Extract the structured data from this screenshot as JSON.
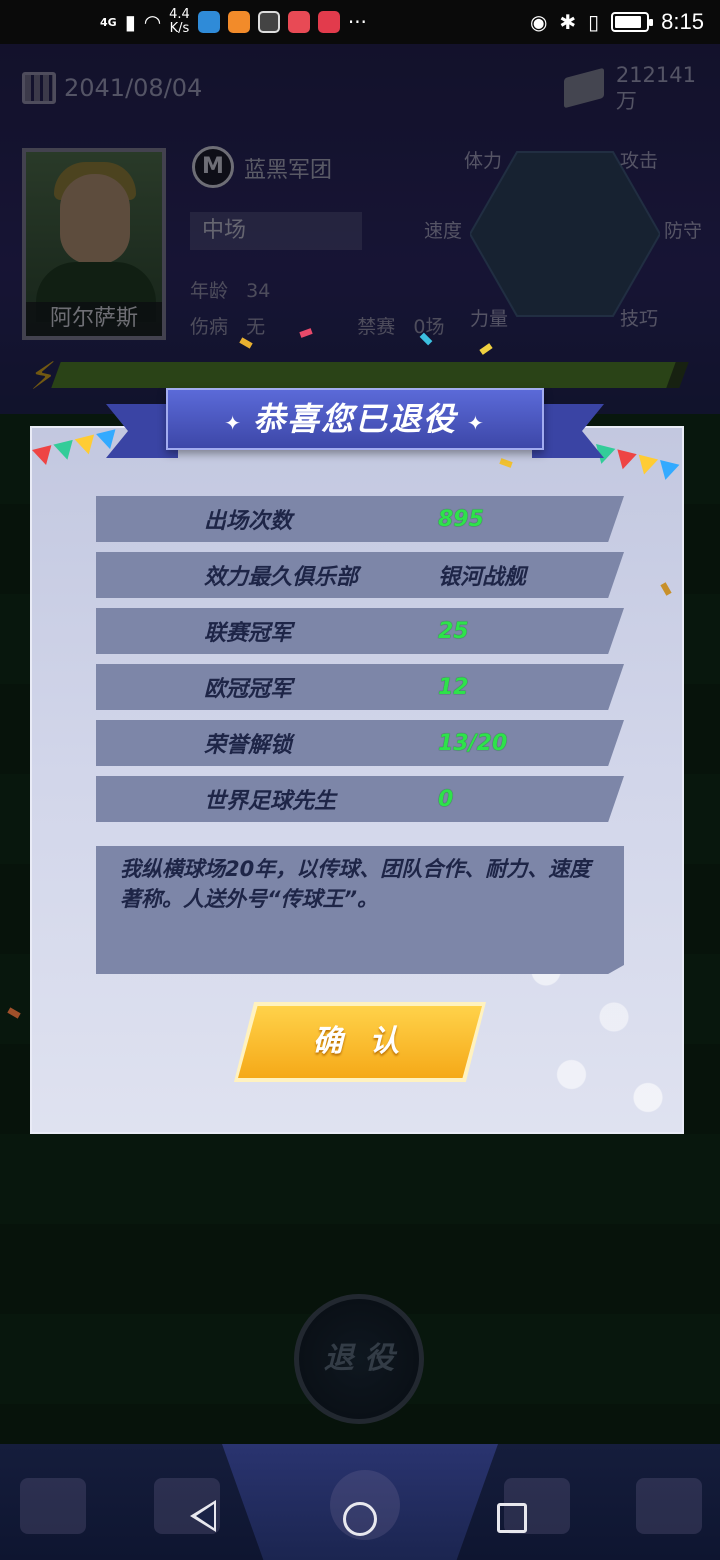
{
  "status_bar": {
    "network": "4G",
    "speed": "4.4\nK/s",
    "time": "8:15",
    "battery_level": 0.85
  },
  "game": {
    "date": "2041/08/04",
    "money_amount": "212141",
    "money_unit": "万",
    "player_name": "阿尔萨斯",
    "club_name": "蓝黑军团",
    "position": "中场",
    "age_label": "年龄",
    "age_value": "34",
    "injury_label": "伤病",
    "injury_value": "无",
    "ban_label": "禁赛",
    "ban_value": "0场",
    "attributes": {
      "stamina": "体力",
      "attack": "攻击",
      "speed": "速度",
      "defense": "防守",
      "strength": "力量",
      "technique": "技巧"
    },
    "xp_fraction": 0.98,
    "retire_button_label": "退 役"
  },
  "dialog": {
    "title": "恭喜您已退役",
    "stats": [
      {
        "label": "出场次数",
        "value": "895",
        "color": "#2ee24a"
      },
      {
        "label": "效力最久俱乐部",
        "value": "银河战舰",
        "color": "#1e2547"
      },
      {
        "label": "联赛冠军",
        "value": "25",
        "color": "#2ee24a"
      },
      {
        "label": "欧冠冠军",
        "value": "12",
        "color": "#2ee24a"
      },
      {
        "label": "荣誉解锁",
        "value": "13/20",
        "color": "#2ee24a"
      },
      {
        "label": "世界足球先生",
        "value": "0",
        "color": "#2ee24a"
      }
    ],
    "bio": "我纵横球场20年，以传球、团队合作、耐力、速度著称。人送外号“传球王”。",
    "confirm_label": "确 认"
  },
  "icons": {
    "sparkle": "✦",
    "club_logo_letter": "M"
  }
}
